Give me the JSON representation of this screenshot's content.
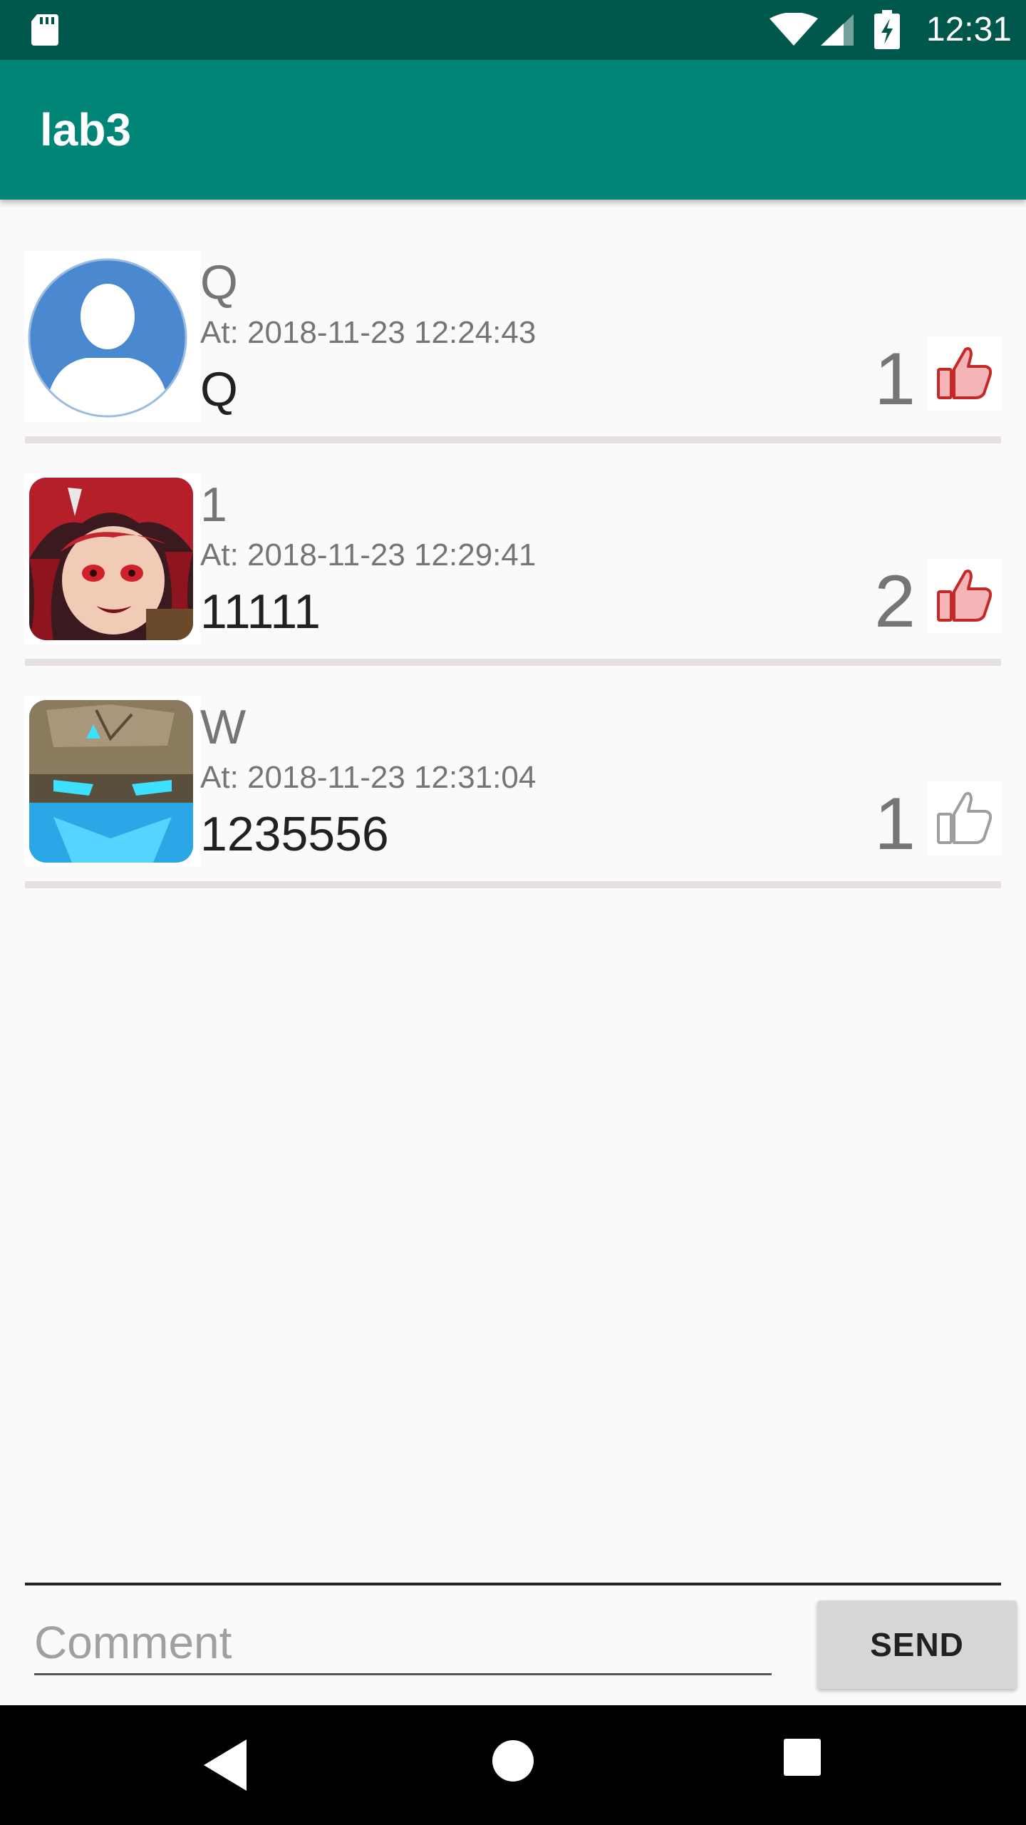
{
  "status_bar": {
    "time": "12:31",
    "icons": [
      "sd-card-icon",
      "wifi-icon",
      "signal-icon",
      "battery-charging-icon"
    ]
  },
  "app_bar": {
    "title": "lab3"
  },
  "comments": [
    {
      "username": "Q",
      "timestamp": "At: 2018-11-23 12:24:43",
      "text": "Q",
      "likes": "1",
      "liked": true,
      "avatar": "default-user-avatar"
    },
    {
      "username": "1",
      "timestamp": "At: 2018-11-23 12:29:41",
      "text": "11111",
      "likes": "2",
      "liked": true,
      "avatar": "red-haired-character-avatar"
    },
    {
      "username": "W",
      "timestamp": "At: 2018-11-23 12:31:04",
      "text": "1235556",
      "likes": "1",
      "liked": false,
      "avatar": "stone-golem-avatar"
    }
  ],
  "comment_box": {
    "placeholder": "Comment",
    "value": "",
    "send_label": "SEND"
  },
  "nav_bar": {
    "icons": [
      "back-icon",
      "home-icon",
      "recents-icon"
    ]
  },
  "colors": {
    "status_bar": "#00574b",
    "app_bar": "#008577",
    "like_active": "#c62828",
    "like_inactive": "#9e9e9e"
  }
}
